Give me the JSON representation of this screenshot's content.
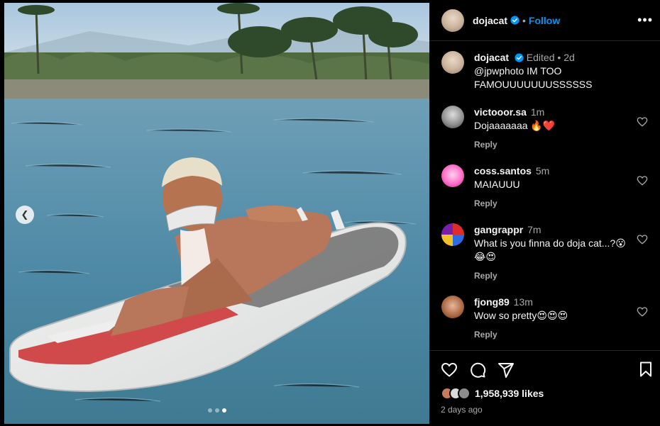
{
  "post": {
    "author": "dojacat",
    "follow_label": "Follow",
    "more_label": "•••",
    "caption": {
      "username": "dojacat",
      "edited": "Edited",
      "dot": "•",
      "time": "2d",
      "text": "@jpwphoto IM TOO FAMOUUUUUUUSSSSSS"
    }
  },
  "comments": [
    {
      "username": "victooor.sa",
      "time": "1m",
      "text": "Dojaaaaaaa 🔥❤️",
      "reply_label": "Reply"
    },
    {
      "username": "coss.santos",
      "time": "5m",
      "text": "MAIAUUU",
      "reply_label": "Reply"
    },
    {
      "username": "gangrappr",
      "time": "7m",
      "text": "What is you finna do doja cat...?😮😂😍",
      "reply_label": "Reply"
    },
    {
      "username": "fjong89",
      "time": "13m",
      "text": "Wow so pretty😍😍😍",
      "reply_label": "Reply"
    }
  ],
  "footer": {
    "likes": "1,958,939 likes",
    "posted": "2 days ago"
  },
  "carousel": {
    "total": 3,
    "current": 3
  },
  "colors": {
    "accent": "#0095f6",
    "secondary_text": "#a8a8a8",
    "border": "#262626"
  },
  "icons": [
    "verified-badge-icon",
    "more-icon",
    "heart-icon",
    "comment-icon",
    "share-icon",
    "bookmark-icon",
    "chevron-left-icon"
  ]
}
